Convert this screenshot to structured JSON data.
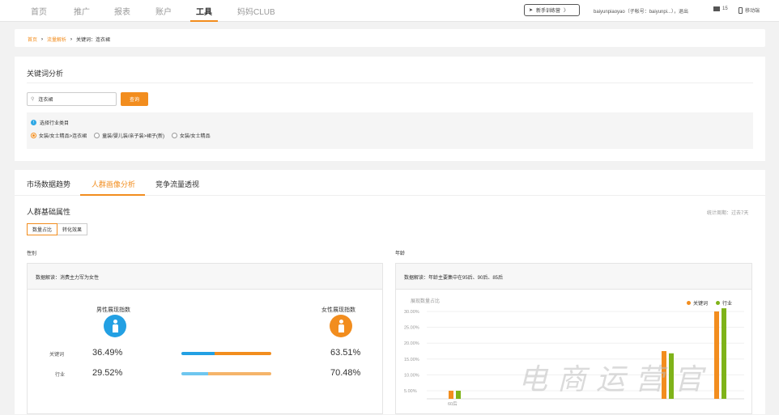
{
  "nav": {
    "items": [
      "首页",
      "推广",
      "报表",
      "账户",
      "工具",
      "妈妈CLUB"
    ],
    "trainer": "新手训练营",
    "user": "baiyunpiaoyao（子帐号：baiyunpi...），退出",
    "messages": "15",
    "mobile": "移动端"
  },
  "breadcrumb": {
    "home": "首页",
    "traffic": "流量解析",
    "current": "关键词：连衣裙"
  },
  "keyword": {
    "title": "关键词分析",
    "search_value": "连衣裙",
    "search_button": "查询",
    "industry_label": "选择行业类目",
    "options": [
      "女装/女士精品>连衣裙",
      "童装/婴儿装/亲子装>裙子(新)",
      "女装/女士精品"
    ]
  },
  "tabs": [
    "市场数据趋势",
    "人群画像分析",
    "竞争流量透视"
  ],
  "section": {
    "title": "人群基础属性",
    "period": "统计周期：过去7天",
    "sub_tabs": [
      "数量占比",
      "转化效果"
    ]
  },
  "gender": {
    "label": "性别",
    "note": "数据解读：消费主力军为女性",
    "male_title": "男性展现指数",
    "female_title": "女性展现指数",
    "rows": [
      {
        "label": "关键词",
        "male": "36.49%",
        "female": "63.51%",
        "male_share": 0.3649
      },
      {
        "label": "行业",
        "male": "29.52%",
        "female": "70.48%",
        "male_share": 0.2952
      }
    ]
  },
  "age": {
    "label": "年龄",
    "note": "数据解读：年龄主要集中在95后、90后、85后"
  },
  "colors": {
    "accent": "#f28d1e",
    "male": "#23a0e3",
    "industry": "#7fb319"
  },
  "chart_data": {
    "type": "bar",
    "ylabel": "展现数量占比",
    "yticks": [
      "30.00%",
      "25.00%",
      "20.00%",
      "15.00%",
      "10.00%",
      "5.00%"
    ],
    "ylim": [
      0,
      32
    ],
    "categories": [
      "60后"
    ],
    "series": [
      {
        "name": "关键词",
        "color": "#f28d1e",
        "values": [
          5,
          17.5,
          30
        ]
      },
      {
        "name": "行业",
        "color": "#7fb319",
        "values": [
          5,
          16.8,
          31
        ]
      }
    ]
  },
  "watermark": "电商运营官"
}
